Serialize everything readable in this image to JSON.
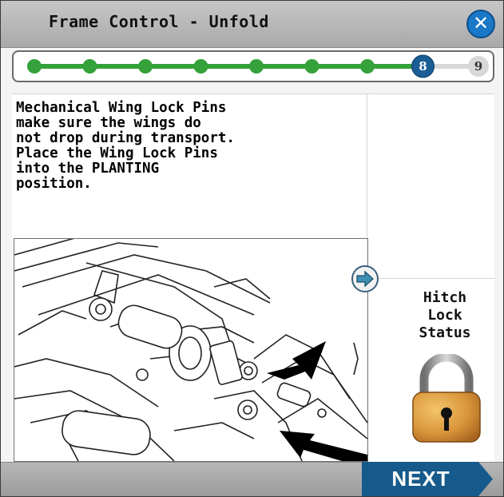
{
  "window": {
    "title": "Frame Control - Unfold",
    "close_label": "✕"
  },
  "progress": {
    "total_steps": 9,
    "current_step": 8,
    "current_label": "8",
    "last_label": "9",
    "completed_color": "#35a13a",
    "current_color": "#1b5e96",
    "pending_color": "#d8d8d8"
  },
  "instructions": {
    "text": "Mechanical Wing Lock Pins\nmake sure the wings do\nnot drop during transport.\nPlace the Wing Lock Pins\ninto the PLANTING\nposition."
  },
  "hitch_status": {
    "label": "Hitch\nLock\nStatus",
    "icon": "padlock-locked-icon"
  },
  "footer": {
    "next_label": "NEXT",
    "next_color": "#155a8a"
  }
}
